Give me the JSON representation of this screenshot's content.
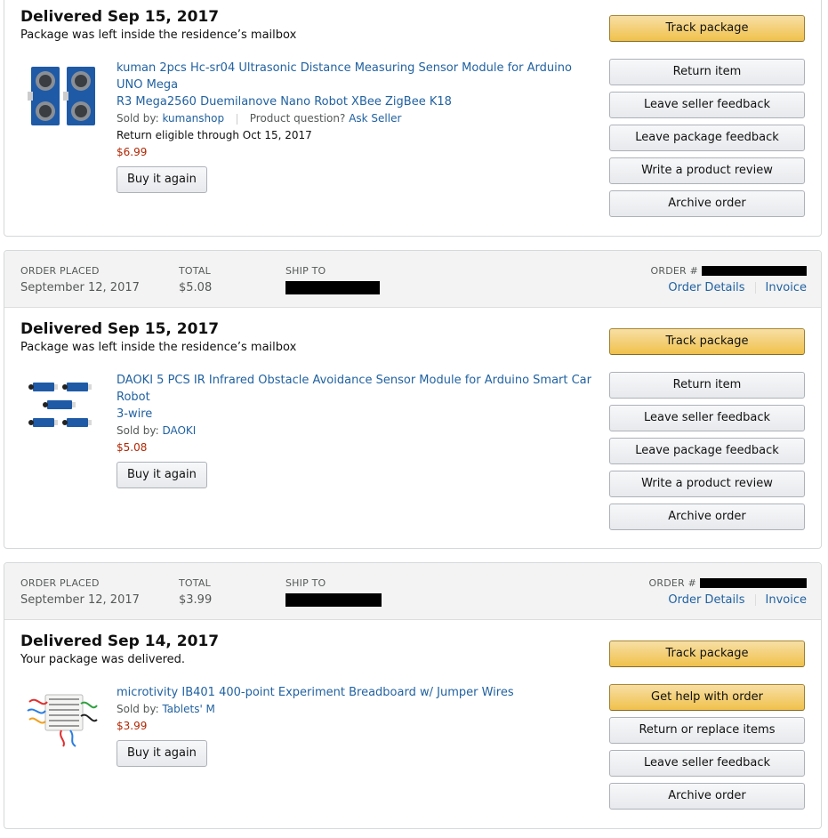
{
  "orders": [
    {
      "status": "Delivered Sep 15, 2017",
      "status_detail": "Package was left inside the residence’s mailbox",
      "item": {
        "title_line1": "kuman 2pcs Hc-sr04 Ultrasonic Distance Measuring Sensor Module for Arduino UNO Mega",
        "title_line2": "R3 Mega2560 Duemilanove Nano Robot XBee ZigBee K18",
        "sold_by_label": "Sold by:",
        "seller": "kumanshop",
        "question_label": "Product question?",
        "ask_seller": "Ask Seller",
        "return_eligible": "Return eligible through Oct 15, 2017",
        "price": "$6.99",
        "buy_again": "Buy it again",
        "image_icon": "ultrasonic-sensor-image"
      },
      "actions": [
        "Track package",
        "Return item",
        "Leave seller feedback",
        "Leave package feedback",
        "Write a product review",
        "Archive order"
      ]
    },
    {
      "header": {
        "order_placed_label": "ORDER PLACED",
        "order_placed": "September 12, 2017",
        "total_label": "TOTAL",
        "total": "$5.08",
        "ship_to_label": "SHIP TO",
        "order_num_label": "ORDER #",
        "order_details": "Order Details",
        "invoice": "Invoice"
      },
      "status": "Delivered Sep 15, 2017",
      "status_detail": "Package was left inside the residence’s mailbox",
      "item": {
        "title_line1": "DAOKI 5 PCS IR Infrared Obstacle Avoidance Sensor Module for Arduino Smart Car Robot",
        "title_line2": "3-wire",
        "sold_by_label": "Sold by:",
        "seller": "DAOKI",
        "price": "$5.08",
        "buy_again": "Buy it again",
        "image_icon": "ir-sensor-modules-image"
      },
      "actions": [
        "Track package",
        "Return item",
        "Leave seller feedback",
        "Leave package feedback",
        "Write a product review",
        "Archive order"
      ]
    },
    {
      "header": {
        "order_placed_label": "ORDER PLACED",
        "order_placed": "September 12, 2017",
        "total_label": "TOTAL",
        "total": "$3.99",
        "ship_to_label": "SHIP TO",
        "order_num_label": "ORDER #",
        "order_details": "Order Details",
        "invoice": "Invoice"
      },
      "status": "Delivered Sep 14, 2017",
      "status_detail": "Your package was delivered.",
      "item": {
        "title_line1": "microtivity IB401 400-point Experiment Breadboard w/ Jumper Wires",
        "sold_by_label": "Sold by:",
        "seller": "Tablets' M",
        "price": "$3.99",
        "buy_again": "Buy it again",
        "image_icon": "breadboard-image"
      },
      "actions": [
        "Track package",
        "Get help with order",
        "Return or replace items",
        "Leave seller feedback",
        "Archive order"
      ]
    }
  ],
  "colors": {
    "link": "#2162a1",
    "price": "#b12704",
    "primary_button": "#f0c14b"
  }
}
